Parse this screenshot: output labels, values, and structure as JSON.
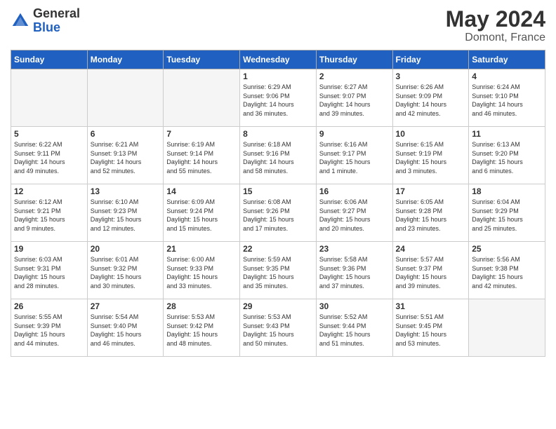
{
  "header": {
    "logo_general": "General",
    "logo_blue": "Blue",
    "main_title": "May 2024",
    "subtitle": "Domont, France"
  },
  "weekdays": [
    "Sunday",
    "Monday",
    "Tuesday",
    "Wednesday",
    "Thursday",
    "Friday",
    "Saturday"
  ],
  "weeks": [
    [
      {
        "day": "",
        "info": ""
      },
      {
        "day": "",
        "info": ""
      },
      {
        "day": "",
        "info": ""
      },
      {
        "day": "1",
        "info": "Sunrise: 6:29 AM\nSunset: 9:06 PM\nDaylight: 14 hours\nand 36 minutes."
      },
      {
        "day": "2",
        "info": "Sunrise: 6:27 AM\nSunset: 9:07 PM\nDaylight: 14 hours\nand 39 minutes."
      },
      {
        "day": "3",
        "info": "Sunrise: 6:26 AM\nSunset: 9:09 PM\nDaylight: 14 hours\nand 42 minutes."
      },
      {
        "day": "4",
        "info": "Sunrise: 6:24 AM\nSunset: 9:10 PM\nDaylight: 14 hours\nand 46 minutes."
      }
    ],
    [
      {
        "day": "5",
        "info": "Sunrise: 6:22 AM\nSunset: 9:11 PM\nDaylight: 14 hours\nand 49 minutes."
      },
      {
        "day": "6",
        "info": "Sunrise: 6:21 AM\nSunset: 9:13 PM\nDaylight: 14 hours\nand 52 minutes."
      },
      {
        "day": "7",
        "info": "Sunrise: 6:19 AM\nSunset: 9:14 PM\nDaylight: 14 hours\nand 55 minutes."
      },
      {
        "day": "8",
        "info": "Sunrise: 6:18 AM\nSunset: 9:16 PM\nDaylight: 14 hours\nand 58 minutes."
      },
      {
        "day": "9",
        "info": "Sunrise: 6:16 AM\nSunset: 9:17 PM\nDaylight: 15 hours\nand 1 minute."
      },
      {
        "day": "10",
        "info": "Sunrise: 6:15 AM\nSunset: 9:19 PM\nDaylight: 15 hours\nand 3 minutes."
      },
      {
        "day": "11",
        "info": "Sunrise: 6:13 AM\nSunset: 9:20 PM\nDaylight: 15 hours\nand 6 minutes."
      }
    ],
    [
      {
        "day": "12",
        "info": "Sunrise: 6:12 AM\nSunset: 9:21 PM\nDaylight: 15 hours\nand 9 minutes."
      },
      {
        "day": "13",
        "info": "Sunrise: 6:10 AM\nSunset: 9:23 PM\nDaylight: 15 hours\nand 12 minutes."
      },
      {
        "day": "14",
        "info": "Sunrise: 6:09 AM\nSunset: 9:24 PM\nDaylight: 15 hours\nand 15 minutes."
      },
      {
        "day": "15",
        "info": "Sunrise: 6:08 AM\nSunset: 9:26 PM\nDaylight: 15 hours\nand 17 minutes."
      },
      {
        "day": "16",
        "info": "Sunrise: 6:06 AM\nSunset: 9:27 PM\nDaylight: 15 hours\nand 20 minutes."
      },
      {
        "day": "17",
        "info": "Sunrise: 6:05 AM\nSunset: 9:28 PM\nDaylight: 15 hours\nand 23 minutes."
      },
      {
        "day": "18",
        "info": "Sunrise: 6:04 AM\nSunset: 9:29 PM\nDaylight: 15 hours\nand 25 minutes."
      }
    ],
    [
      {
        "day": "19",
        "info": "Sunrise: 6:03 AM\nSunset: 9:31 PM\nDaylight: 15 hours\nand 28 minutes."
      },
      {
        "day": "20",
        "info": "Sunrise: 6:01 AM\nSunset: 9:32 PM\nDaylight: 15 hours\nand 30 minutes."
      },
      {
        "day": "21",
        "info": "Sunrise: 6:00 AM\nSunset: 9:33 PM\nDaylight: 15 hours\nand 33 minutes."
      },
      {
        "day": "22",
        "info": "Sunrise: 5:59 AM\nSunset: 9:35 PM\nDaylight: 15 hours\nand 35 minutes."
      },
      {
        "day": "23",
        "info": "Sunrise: 5:58 AM\nSunset: 9:36 PM\nDaylight: 15 hours\nand 37 minutes."
      },
      {
        "day": "24",
        "info": "Sunrise: 5:57 AM\nSunset: 9:37 PM\nDaylight: 15 hours\nand 39 minutes."
      },
      {
        "day": "25",
        "info": "Sunrise: 5:56 AM\nSunset: 9:38 PM\nDaylight: 15 hours\nand 42 minutes."
      }
    ],
    [
      {
        "day": "26",
        "info": "Sunrise: 5:55 AM\nSunset: 9:39 PM\nDaylight: 15 hours\nand 44 minutes."
      },
      {
        "day": "27",
        "info": "Sunrise: 5:54 AM\nSunset: 9:40 PM\nDaylight: 15 hours\nand 46 minutes."
      },
      {
        "day": "28",
        "info": "Sunrise: 5:53 AM\nSunset: 9:42 PM\nDaylight: 15 hours\nand 48 minutes."
      },
      {
        "day": "29",
        "info": "Sunrise: 5:53 AM\nSunset: 9:43 PM\nDaylight: 15 hours\nand 50 minutes."
      },
      {
        "day": "30",
        "info": "Sunrise: 5:52 AM\nSunset: 9:44 PM\nDaylight: 15 hours\nand 51 minutes."
      },
      {
        "day": "31",
        "info": "Sunrise: 5:51 AM\nSunset: 9:45 PM\nDaylight: 15 hours\nand 53 minutes."
      },
      {
        "day": "",
        "info": ""
      }
    ]
  ]
}
